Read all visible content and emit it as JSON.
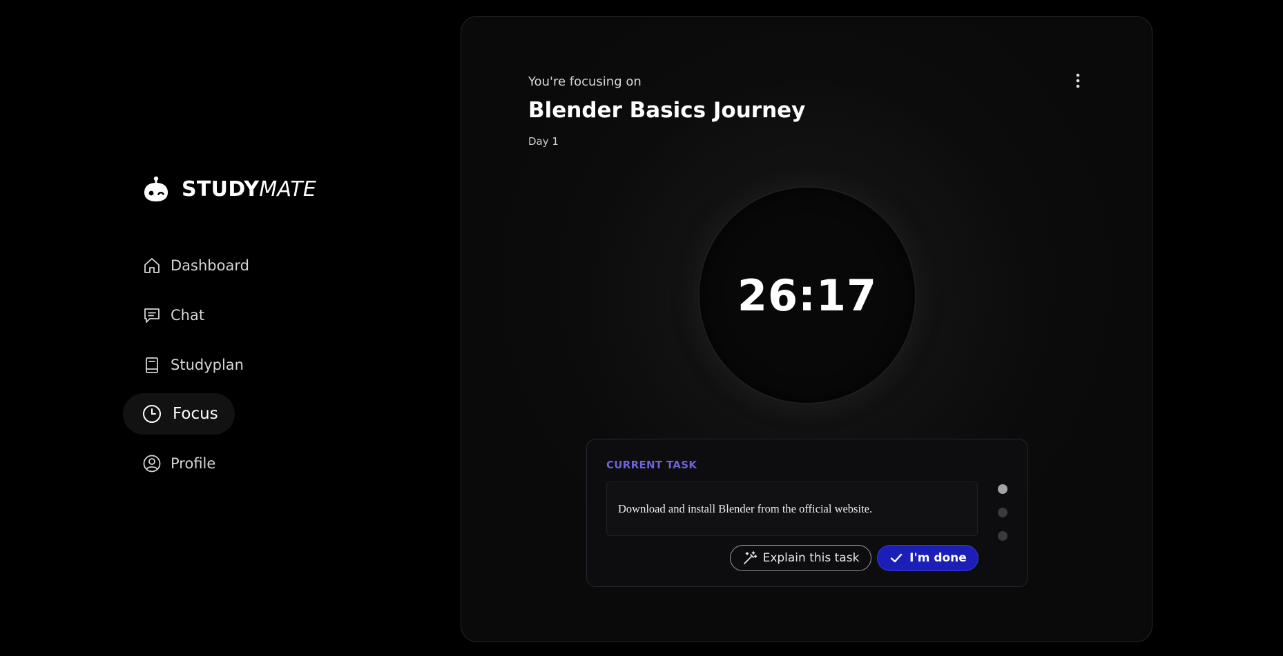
{
  "brand": {
    "name_bold": "STUDY",
    "name_italic": "MATE",
    "logo_icon": "robot-face-icon"
  },
  "sidebar": {
    "items": [
      {
        "label": "Dashboard",
        "icon": "home-icon",
        "active": false
      },
      {
        "label": "Chat",
        "icon": "chat-icon",
        "active": false
      },
      {
        "label": "Studyplan",
        "icon": "book-icon",
        "active": false
      },
      {
        "label": "Focus",
        "icon": "clock-icon",
        "active": true
      },
      {
        "label": "Profile",
        "icon": "user-circle-icon",
        "active": false
      }
    ]
  },
  "focus": {
    "caption": "You're focusing on",
    "title": "Blender Basics Journey",
    "day": "Day 1",
    "timer": "26:17",
    "more_icon": "vertical-dots-icon"
  },
  "task": {
    "heading": "CURRENT TASK",
    "text": "Download and install Blender from the official website.",
    "explain_label": "Explain this task",
    "explain_icon": "magic-wand-icon",
    "done_label": "I'm done",
    "done_icon": "check-icon",
    "pager_count": 3,
    "pager_active": 0
  },
  "colors": {
    "background": "#000000",
    "accent": "#6b63d8",
    "primary_button": "#1b1fb8"
  }
}
